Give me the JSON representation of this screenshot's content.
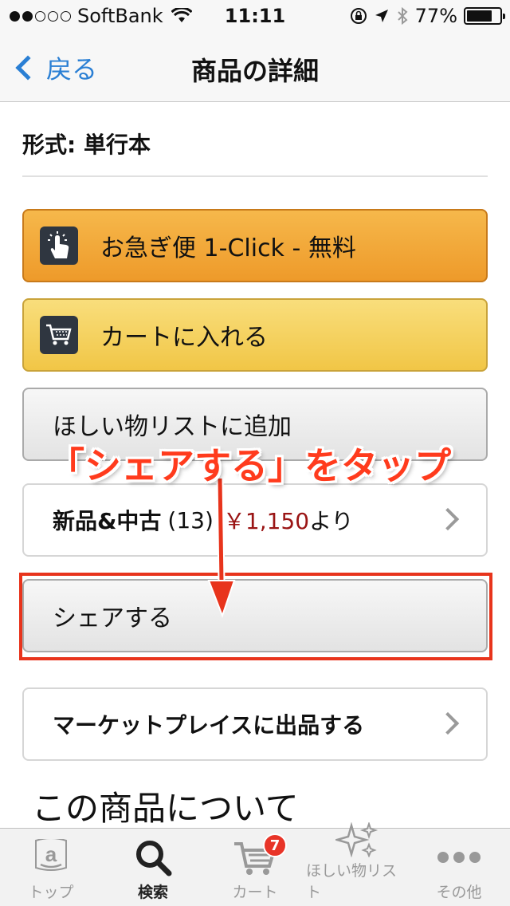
{
  "status_bar": {
    "carrier": "SoftBank",
    "time": "11:11",
    "battery": "77%",
    "battery_level": 0.77
  },
  "nav": {
    "back_label": "戻る",
    "title": "商品の詳細"
  },
  "format": "形式: 単行本",
  "buttons": {
    "one_click": "お急ぎ便 1-Click - 無料",
    "add_to_cart": "カートに入れる",
    "add_to_wishlist": "ほしい物リストに追加",
    "share": "シェアする"
  },
  "offers": {
    "label": "新品&中古",
    "count": "(13)",
    "price": "￥1,150",
    "suffix": "より"
  },
  "marketplace": "マーケットプレイスに出品する",
  "annotation": "「シェアする」をタップ",
  "section_title": "この商品について",
  "tabs": [
    {
      "label": "トップ",
      "icon": "amazon-a-icon"
    },
    {
      "label": "検索",
      "icon": "search-icon"
    },
    {
      "label": "カート",
      "icon": "cart-icon",
      "badge": "7"
    },
    {
      "label": "ほしい物リスト",
      "icon": "sparkle-icon"
    },
    {
      "label": "その他",
      "icon": "more-dots-icon"
    }
  ],
  "colors": {
    "accent": "#2a7fd4",
    "one_click": "#ee9a2a",
    "cart": "#f1c646",
    "annotation": "#ff3b1d",
    "price": "#9a1414"
  }
}
